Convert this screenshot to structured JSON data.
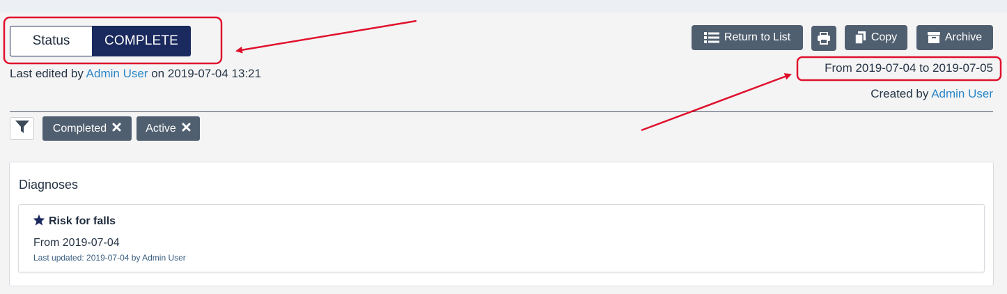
{
  "status": {
    "label": "Status",
    "value": "COMPLETE"
  },
  "edited": {
    "prefix": "Last edited by",
    "user": "Admin User",
    "on": "on",
    "datetime": "2019-07-04 13:21"
  },
  "toolbar": {
    "return_label": "Return to List",
    "copy_label": "Copy",
    "archive_label": "Archive"
  },
  "date_range": {
    "text": "From 2019-07-04 to 2019-07-05"
  },
  "created": {
    "prefix": "Created by",
    "user": "Admin User"
  },
  "filters": {
    "chips": [
      {
        "label": "Completed"
      },
      {
        "label": "Active"
      }
    ]
  },
  "diagnoses": {
    "title": "Diagnoses",
    "items": [
      {
        "title": "Risk for falls",
        "from": "From 2019-07-04",
        "updated": "Last updated: 2019-07-04 by Admin User"
      }
    ]
  },
  "colors": {
    "status_accent": "#1a2a5e",
    "button_bg": "#505f70",
    "link": "#2a86c8",
    "annotation": "#e0102c"
  },
  "icons": [
    "list-icon",
    "print-icon",
    "copy-icon",
    "archive-icon",
    "filter-icon",
    "close-icon",
    "star-icon"
  ]
}
